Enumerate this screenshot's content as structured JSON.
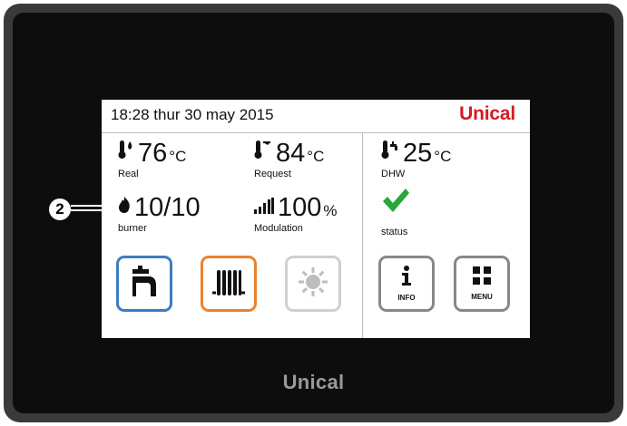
{
  "device": {
    "brand_bottom": "Unical",
    "callout_number": "2"
  },
  "screen": {
    "datetime": "18:28  thur 30 may 2015",
    "logo": "Unical",
    "logo_color": "#d71920",
    "metrics": {
      "real": {
        "value": "76",
        "unit": "°C",
        "label": "Real",
        "icon": "thermometer-flame-icon"
      },
      "request": {
        "value": "84",
        "unit": "°C",
        "label": "Request",
        "icon": "thermometer-request-icon"
      },
      "burner": {
        "value": "10/10",
        "unit": "",
        "label": "burner",
        "icon": "flame-icon"
      },
      "modulation": {
        "value": "100",
        "unit": "%",
        "label": "Modulation",
        "icon": "signal-bars-icon"
      },
      "dhw": {
        "value": "25",
        "unit": "°C",
        "label": "DHW",
        "icon": "thermometer-tap-icon"
      }
    },
    "status": {
      "label": "status",
      "icon": "checkmark-icon",
      "color": "#2aa53a"
    },
    "buttons": {
      "dhw": {
        "icon": "tap-icon",
        "border_color": "#3d7cc0"
      },
      "heating": {
        "icon": "radiator-icon",
        "border_color": "#e8822e"
      },
      "summer": {
        "icon": "sun-icon",
        "border_color": "#cfcfcf",
        "state": "disabled"
      },
      "info": {
        "icon": "info-icon",
        "caption": "INFO",
        "border_color": "#888888"
      },
      "menu": {
        "icon": "grid-icon",
        "caption": "MENU",
        "border_color": "#888888"
      }
    }
  }
}
